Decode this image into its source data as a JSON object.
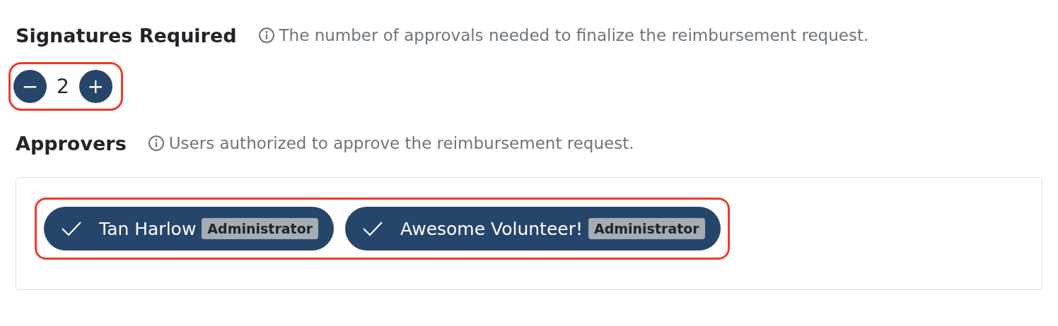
{
  "signatures": {
    "title": "Signatures Required",
    "info": "The number of approvals needed to finalize the reimbursement request.",
    "decrement": "−",
    "value": "2",
    "increment": "+",
    "highlighted": true
  },
  "approvers": {
    "title": "Approvers",
    "info": "Users authorized to approve the reimbursement request.",
    "highlighted": true,
    "users": [
      {
        "name": "Tan Harlow",
        "role": "Administrator",
        "selected": true
      },
      {
        "name": "Awesome Volunteer!",
        "role": "Administrator",
        "selected": true
      }
    ]
  }
}
